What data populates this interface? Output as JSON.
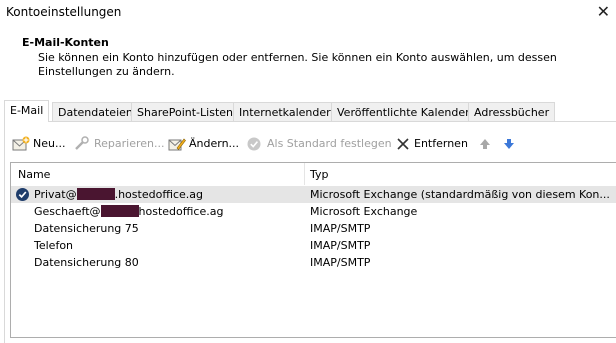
{
  "window": {
    "title": "Kontoeinstellungen"
  },
  "header": {
    "title": "E-Mail-Konten",
    "description": "Sie können ein Konto hinzufügen oder entfernen. Sie können ein Konto auswählen, um dessen Einstellungen zu ändern."
  },
  "tabs": [
    {
      "label": "E-Mail",
      "active": true
    },
    {
      "label": "Datendateien"
    },
    {
      "label": "SharePoint-Listen"
    },
    {
      "label": "Internetkalender"
    },
    {
      "label": "Veröffentlichte Kalender"
    },
    {
      "label": "Adressbücher"
    }
  ],
  "toolbar": {
    "new_label": "Neu...",
    "repair_label": "Reparieren...",
    "change_label": "Ändern...",
    "default_label": "Als Standard festlegen",
    "remove_label": "Entfernen"
  },
  "list": {
    "col_name": "Name",
    "col_type": "Typ",
    "rows": [
      {
        "name_pre": "Privat@",
        "name_post": ".hostedoffice.ag",
        "type": "Microsoft Exchange (standardmäßig von diesem Kon...",
        "selected": true,
        "default": true
      },
      {
        "name_pre": "Geschaeft@",
        "name_post": "hostedoffice.ag",
        "type": "Microsoft Exchange"
      },
      {
        "name": "Datensicherung 75",
        "type": "IMAP/SMTP"
      },
      {
        "name": "Telefon",
        "type": "IMAP/SMTP"
      },
      {
        "name": "Datensicherung 80",
        "type": "IMAP/SMTP"
      }
    ]
  },
  "colors": {
    "accent": "#1a5fb4",
    "redaction": "#4a1530",
    "selection": "#e5e5e5"
  }
}
